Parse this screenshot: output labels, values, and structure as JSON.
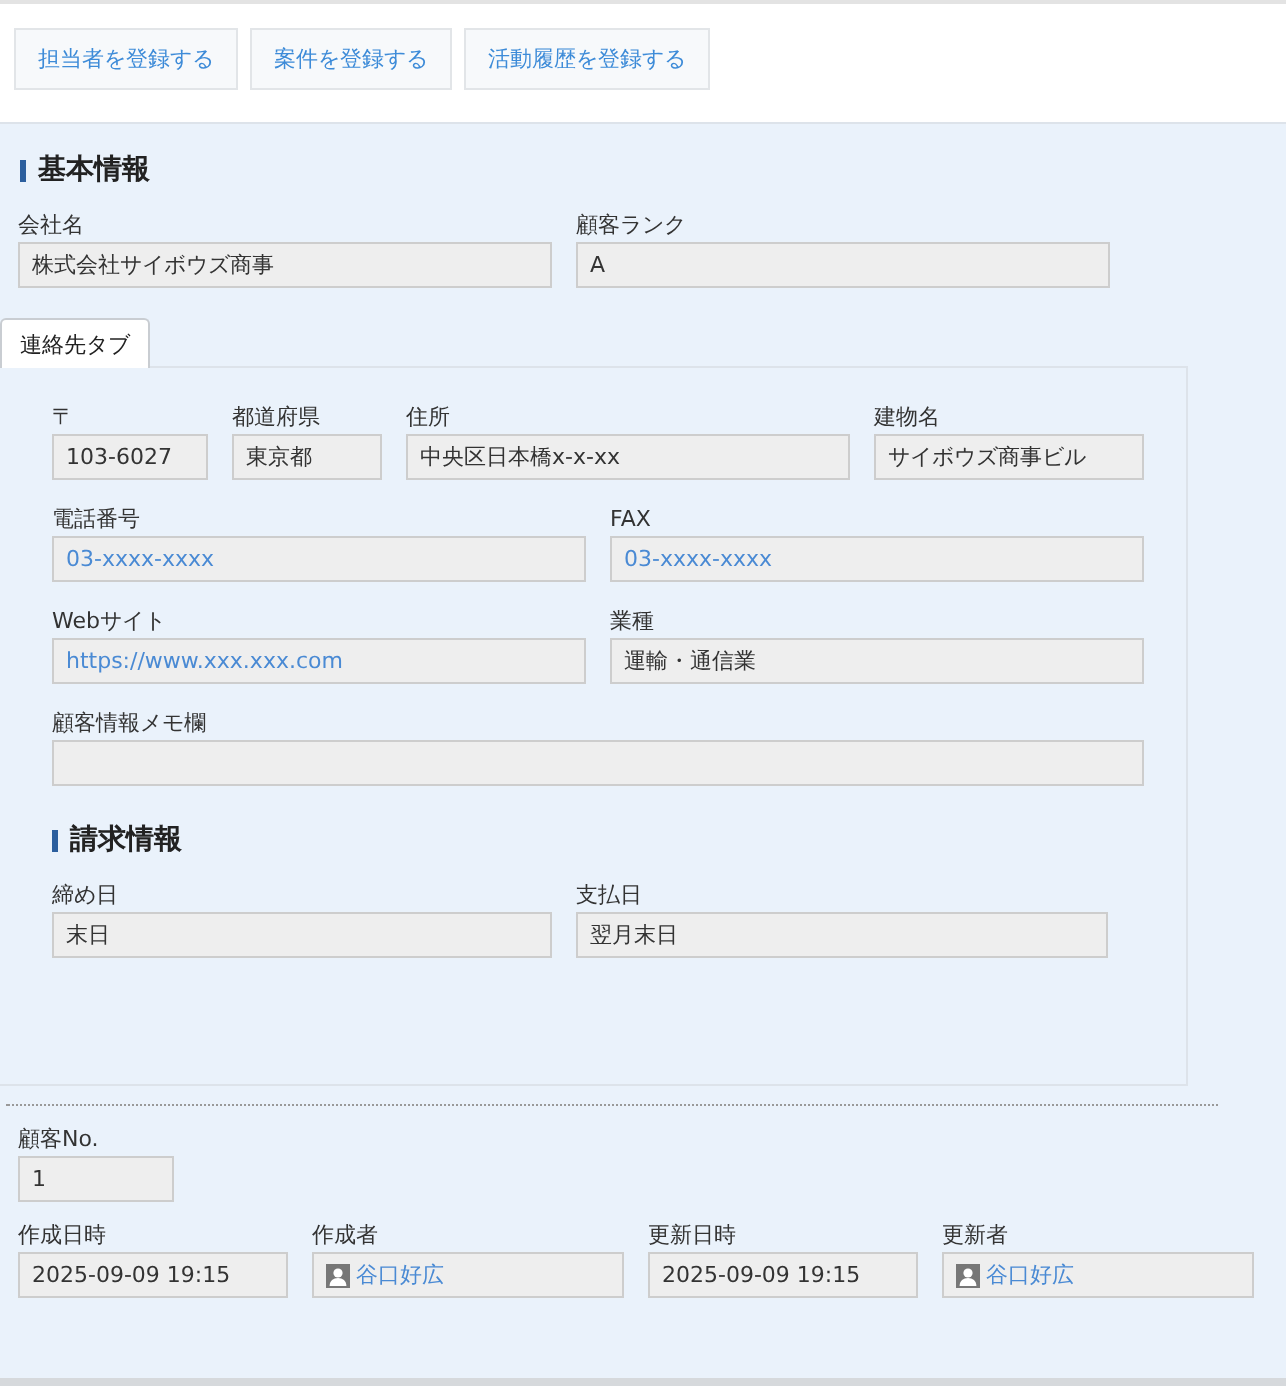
{
  "actions": [
    "担当者を登録する",
    "案件を登録する",
    "活動履歴を登録する"
  ],
  "basic": {
    "heading": "基本情報",
    "rows": [
      [
        {
          "label": "会社名",
          "value": "株式会社サイボウズ商事",
          "kind": "text"
        },
        {
          "label": "顧客ランク",
          "value": "A",
          "kind": "text"
        }
      ]
    ]
  },
  "tab": {
    "label": "連絡先タブ",
    "selected": true
  },
  "contact": {
    "rows": [
      [
        {
          "label": "〒",
          "value": "103-6027",
          "kind": "text"
        },
        {
          "label": "都道府県",
          "value": "東京都",
          "kind": "text"
        },
        {
          "label": "住所",
          "value": "中央区日本橋x-x-xx",
          "kind": "text"
        },
        {
          "label": "建物名",
          "value": "サイボウズ商事ビル",
          "kind": "text"
        }
      ],
      [
        {
          "label": "電話番号",
          "value": "03-xxxx-xxxx",
          "kind": "link"
        },
        {
          "label": "FAX",
          "value": "03-xxxx-xxxx",
          "kind": "link"
        }
      ],
      [
        {
          "label": "Webサイト",
          "value": "https://www.xxx.xxx.com",
          "kind": "link"
        },
        {
          "label": "業種",
          "value": "運輸・通信業",
          "kind": "text"
        }
      ],
      [
        {
          "label": "顧客情報メモ欄",
          "kind": "text"
        }
      ]
    ]
  },
  "billing": {
    "heading": "請求情報",
    "rows": [
      [
        {
          "label": "締め日",
          "value": "末日",
          "kind": "text"
        },
        {
          "label": "支払日",
          "value": "翌月末日",
          "kind": "text"
        }
      ]
    ]
  },
  "meta": {
    "rows": [
      [
        {
          "label": "顧客No.",
          "value": "1",
          "kind": "text"
        }
      ],
      [
        {
          "label": "作成日時",
          "value": "2025-09-09 19:15",
          "kind": "text"
        },
        {
          "label": "作成者",
          "value": "谷口好広",
          "kind": "user"
        },
        {
          "label": "更新日時",
          "value": "2025-09-09 19:15",
          "kind": "text"
        },
        {
          "label": "更新者",
          "value": "谷口好広",
          "kind": "user"
        }
      ]
    ]
  }
}
